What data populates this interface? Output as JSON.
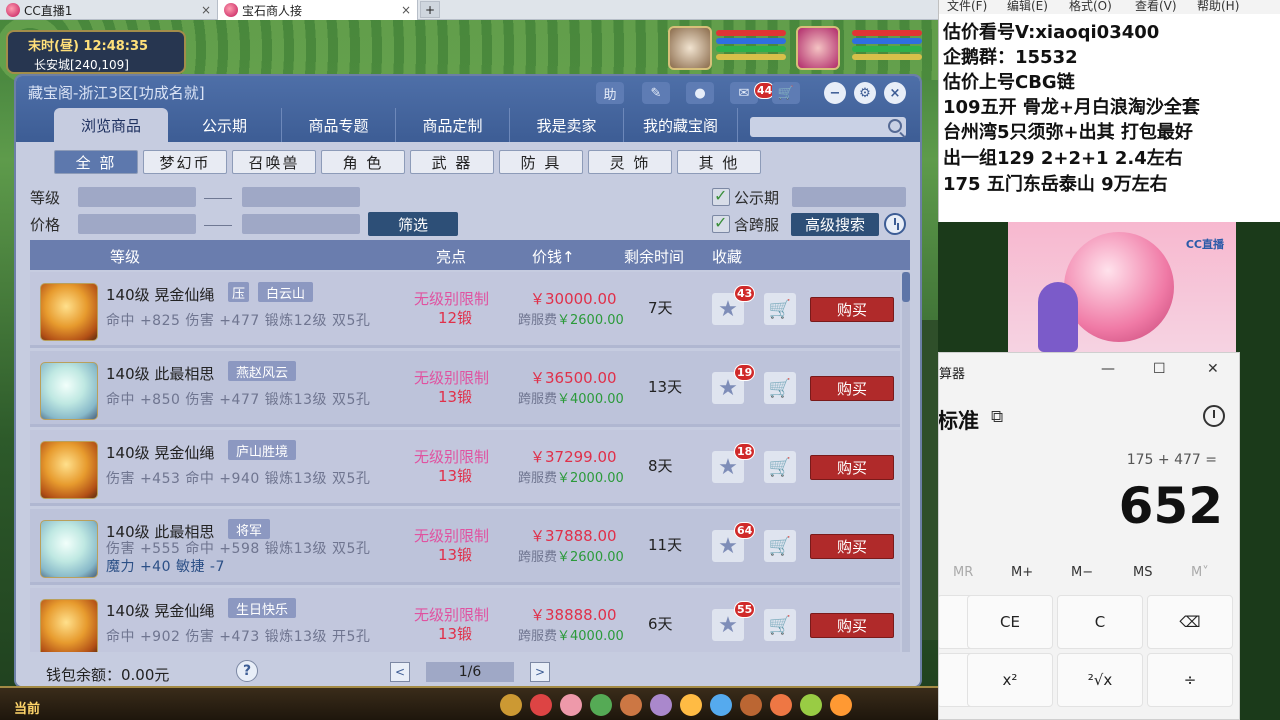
{
  "browser": {
    "tabs": [
      {
        "label": "CC直播1",
        "close": "×"
      },
      {
        "label": "宝石商人接",
        "close": "×"
      }
    ],
    "new_tab": "+"
  },
  "game": {
    "clock_line1": "末时(昼)  12:48:35",
    "clock_line2": "长安城[240,109]",
    "bottom_current": "当前"
  },
  "window": {
    "title": "藏宝阁-浙江3区[功成名就]",
    "help_btn": "助",
    "notify_count": "44",
    "tabs": [
      "浏览商品",
      "公示期",
      "商品专题",
      "商品定制",
      "我是卖家",
      "我的藏宝阁"
    ],
    "active_tab": 0
  },
  "categories": [
    "全 部",
    "梦幻币",
    "召唤兽",
    "角 色",
    "武 器",
    "防 具",
    "灵 饰",
    "其 他"
  ],
  "filters": {
    "level_label": "等级",
    "price_label": "价格",
    "filter_button": "筛选",
    "publicity_label": "公示期",
    "cross_server_label": "含跨服",
    "advanced_search": "高级搜索"
  },
  "table": {
    "headers": {
      "level": "等级",
      "highlight": "亮点",
      "price": "价钱↑",
      "remaining": "剩余时间",
      "favorite": "收藏"
    },
    "rows": [
      {
        "name": "140级 晃金仙绳",
        "tags": [
          "压",
          "白云山"
        ],
        "stats": "命中 +825 伤害 +477 锻炼12级 双5孔",
        "stats2": "",
        "hl1": "无级别限制",
        "hl2": "12锻",
        "price": "￥30000.00",
        "fee_label": "跨服费",
        "fee": "￥2600.00",
        "days": "7天",
        "fav_count": "43",
        "buy": "购买",
        "icon": "gold"
      },
      {
        "name": "140级 此最相思",
        "tags": [
          "燕赵风云"
        ],
        "stats": "命中 +850 伤害 +477 锻炼13级 双5孔",
        "stats2": "",
        "hl1": "无级别限制",
        "hl2": "13锻",
        "price": "￥36500.00",
        "fee_label": "跨服费",
        "fee": "￥4000.00",
        "days": "13天",
        "fav_count": "19",
        "buy": "购买",
        "icon": "jade"
      },
      {
        "name": "140级 晃金仙绳",
        "tags": [
          "庐山胜境"
        ],
        "stats": "伤害 +453 命中 +940 锻炼13级 双5孔",
        "stats2": "",
        "hl1": "无级别限制",
        "hl2": "13锻",
        "price": "￥37299.00",
        "fee_label": "跨服费",
        "fee": "￥2000.00",
        "days": "8天",
        "fav_count": "18",
        "buy": "购买",
        "icon": "gold"
      },
      {
        "name": "140级 此最相思",
        "tags": [
          "将军"
        ],
        "stats": "伤害 +555 命中 +598 锻炼13级 双5孔",
        "stats2": "魔力 +40 敏捷 -7",
        "hl1": "无级别限制",
        "hl2": "13锻",
        "price": "￥37888.00",
        "fee_label": "跨服费",
        "fee": "￥2600.00",
        "days": "11天",
        "fav_count": "64",
        "buy": "购买",
        "icon": "jade"
      },
      {
        "name": "140级 晃金仙绳",
        "tags": [
          "生日快乐"
        ],
        "stats": "命中 +902 伤害 +473 锻炼13级 开5孔",
        "stats2": "",
        "hl1": "无级别限制",
        "hl2": "13锻",
        "price": "￥38888.00",
        "fee_label": "跨服费",
        "fee": "￥4000.00",
        "days": "6天",
        "fav_count": "55",
        "buy": "购买",
        "icon": "gold"
      }
    ]
  },
  "footer": {
    "wallet": "钱包余额：0.00元",
    "help": "?",
    "prev": "<",
    "page": "1/6",
    "next": ">"
  },
  "notepad": {
    "menu": [
      "文件(F)",
      "编辑(E)",
      "格式(O)",
      "查看(V)",
      "帮助(H)"
    ],
    "lines": [
      "估价看号V:xiaoqi03400",
      "企鹅群：15532",
      "估价上号CBG链",
      "109五开 骨龙+月白浪淘沙全套",
      "台州湾5只须弥+出其 打包最好",
      "出一组129 2+2+1   2.4左右",
      "175 五门东岳泰山  9万左右"
    ]
  },
  "ad": {
    "logo": "CC直播"
  },
  "calculator": {
    "title": "算器",
    "mode": "标准",
    "expression": "175 + 477 =",
    "result": "652",
    "memory": [
      "MR",
      "M+",
      "M−",
      "MS",
      "M˅"
    ],
    "keys": [
      "CE",
      "C",
      "⌫",
      "x²",
      "²√x",
      "÷"
    ]
  }
}
